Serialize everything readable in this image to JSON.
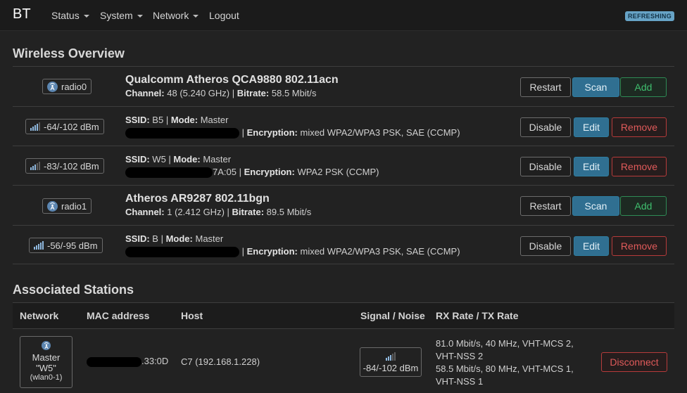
{
  "header": {
    "brand": "BT",
    "menu": [
      "Status",
      "System",
      "Network",
      "Logout"
    ],
    "refresh_badge": "REFRESHING"
  },
  "wireless": {
    "title": "Wireless Overview",
    "radios": [
      {
        "badge": "radio0",
        "name": "Qualcomm Atheros QCA9880 802.11acn",
        "channel_label": "Channel:",
        "channel": "48 (5.240 GHz)",
        "bitrate_label": "Bitrate:",
        "bitrate": "58.5 Mbit/s",
        "buttons": [
          "Restart",
          "Scan",
          "Add"
        ]
      },
      {
        "badge": "radio1",
        "name": "Atheros AR9287 802.11bgn",
        "channel_label": "Channel:",
        "channel": "1 (2.412 GHz)",
        "bitrate_label": "Bitrate:",
        "bitrate": "89.5 Mbit/s",
        "buttons": [
          "Restart",
          "Scan",
          "Add"
        ]
      }
    ],
    "networks": [
      {
        "signal": "-64/-102 dBm",
        "ssid_label": "SSID:",
        "ssid": "B5",
        "mode_label": "Mode:",
        "mode": "Master",
        "bssid_tail": "",
        "enc_label": "Encryption:",
        "encryption": "mixed WPA2/WPA3 PSK, SAE (CCMP)",
        "buttons": [
          "Disable",
          "Edit",
          "Remove"
        ]
      },
      {
        "signal": "-83/-102 dBm",
        "ssid_label": "SSID:",
        "ssid": "W5",
        "mode_label": "Mode:",
        "mode": "Master",
        "bssid_tail": "7A:05",
        "enc_label": "Encryption:",
        "encryption": "WPA2 PSK (CCMP)",
        "buttons": [
          "Disable",
          "Edit",
          "Remove"
        ]
      },
      {
        "signal": "-56/-95 dBm",
        "ssid_label": "SSID:",
        "ssid": "B",
        "mode_label": "Mode:",
        "mode": "Master",
        "bssid_tail": "",
        "enc_label": "Encryption:",
        "encryption": "mixed WPA2/WPA3 PSK, SAE (CCMP)",
        "buttons": [
          "Disable",
          "Edit",
          "Remove"
        ]
      }
    ]
  },
  "stations": {
    "title": "Associated Stations",
    "columns": [
      "Network",
      "MAC address",
      "Host",
      "Signal / Noise",
      "RX Rate / TX Rate"
    ],
    "rows": [
      {
        "network_mode": "Master",
        "network_ssid": "\"W5\"",
        "network_iface": "(wlan0-1)",
        "mac_tail": ".33:0D",
        "host": "C7 (192.168.1.228)",
        "signal": "-84/-102 dBm",
        "rx_line1": "81.0 Mbit/s, 40 MHz, VHT-MCS 2,",
        "rx_line2": "VHT-NSS 2",
        "tx_line1": "58.5 Mbit/s, 80 MHz, VHT-MCS 1,",
        "tx_line2": "VHT-NSS 1",
        "action": "Disconnect"
      }
    ]
  }
}
